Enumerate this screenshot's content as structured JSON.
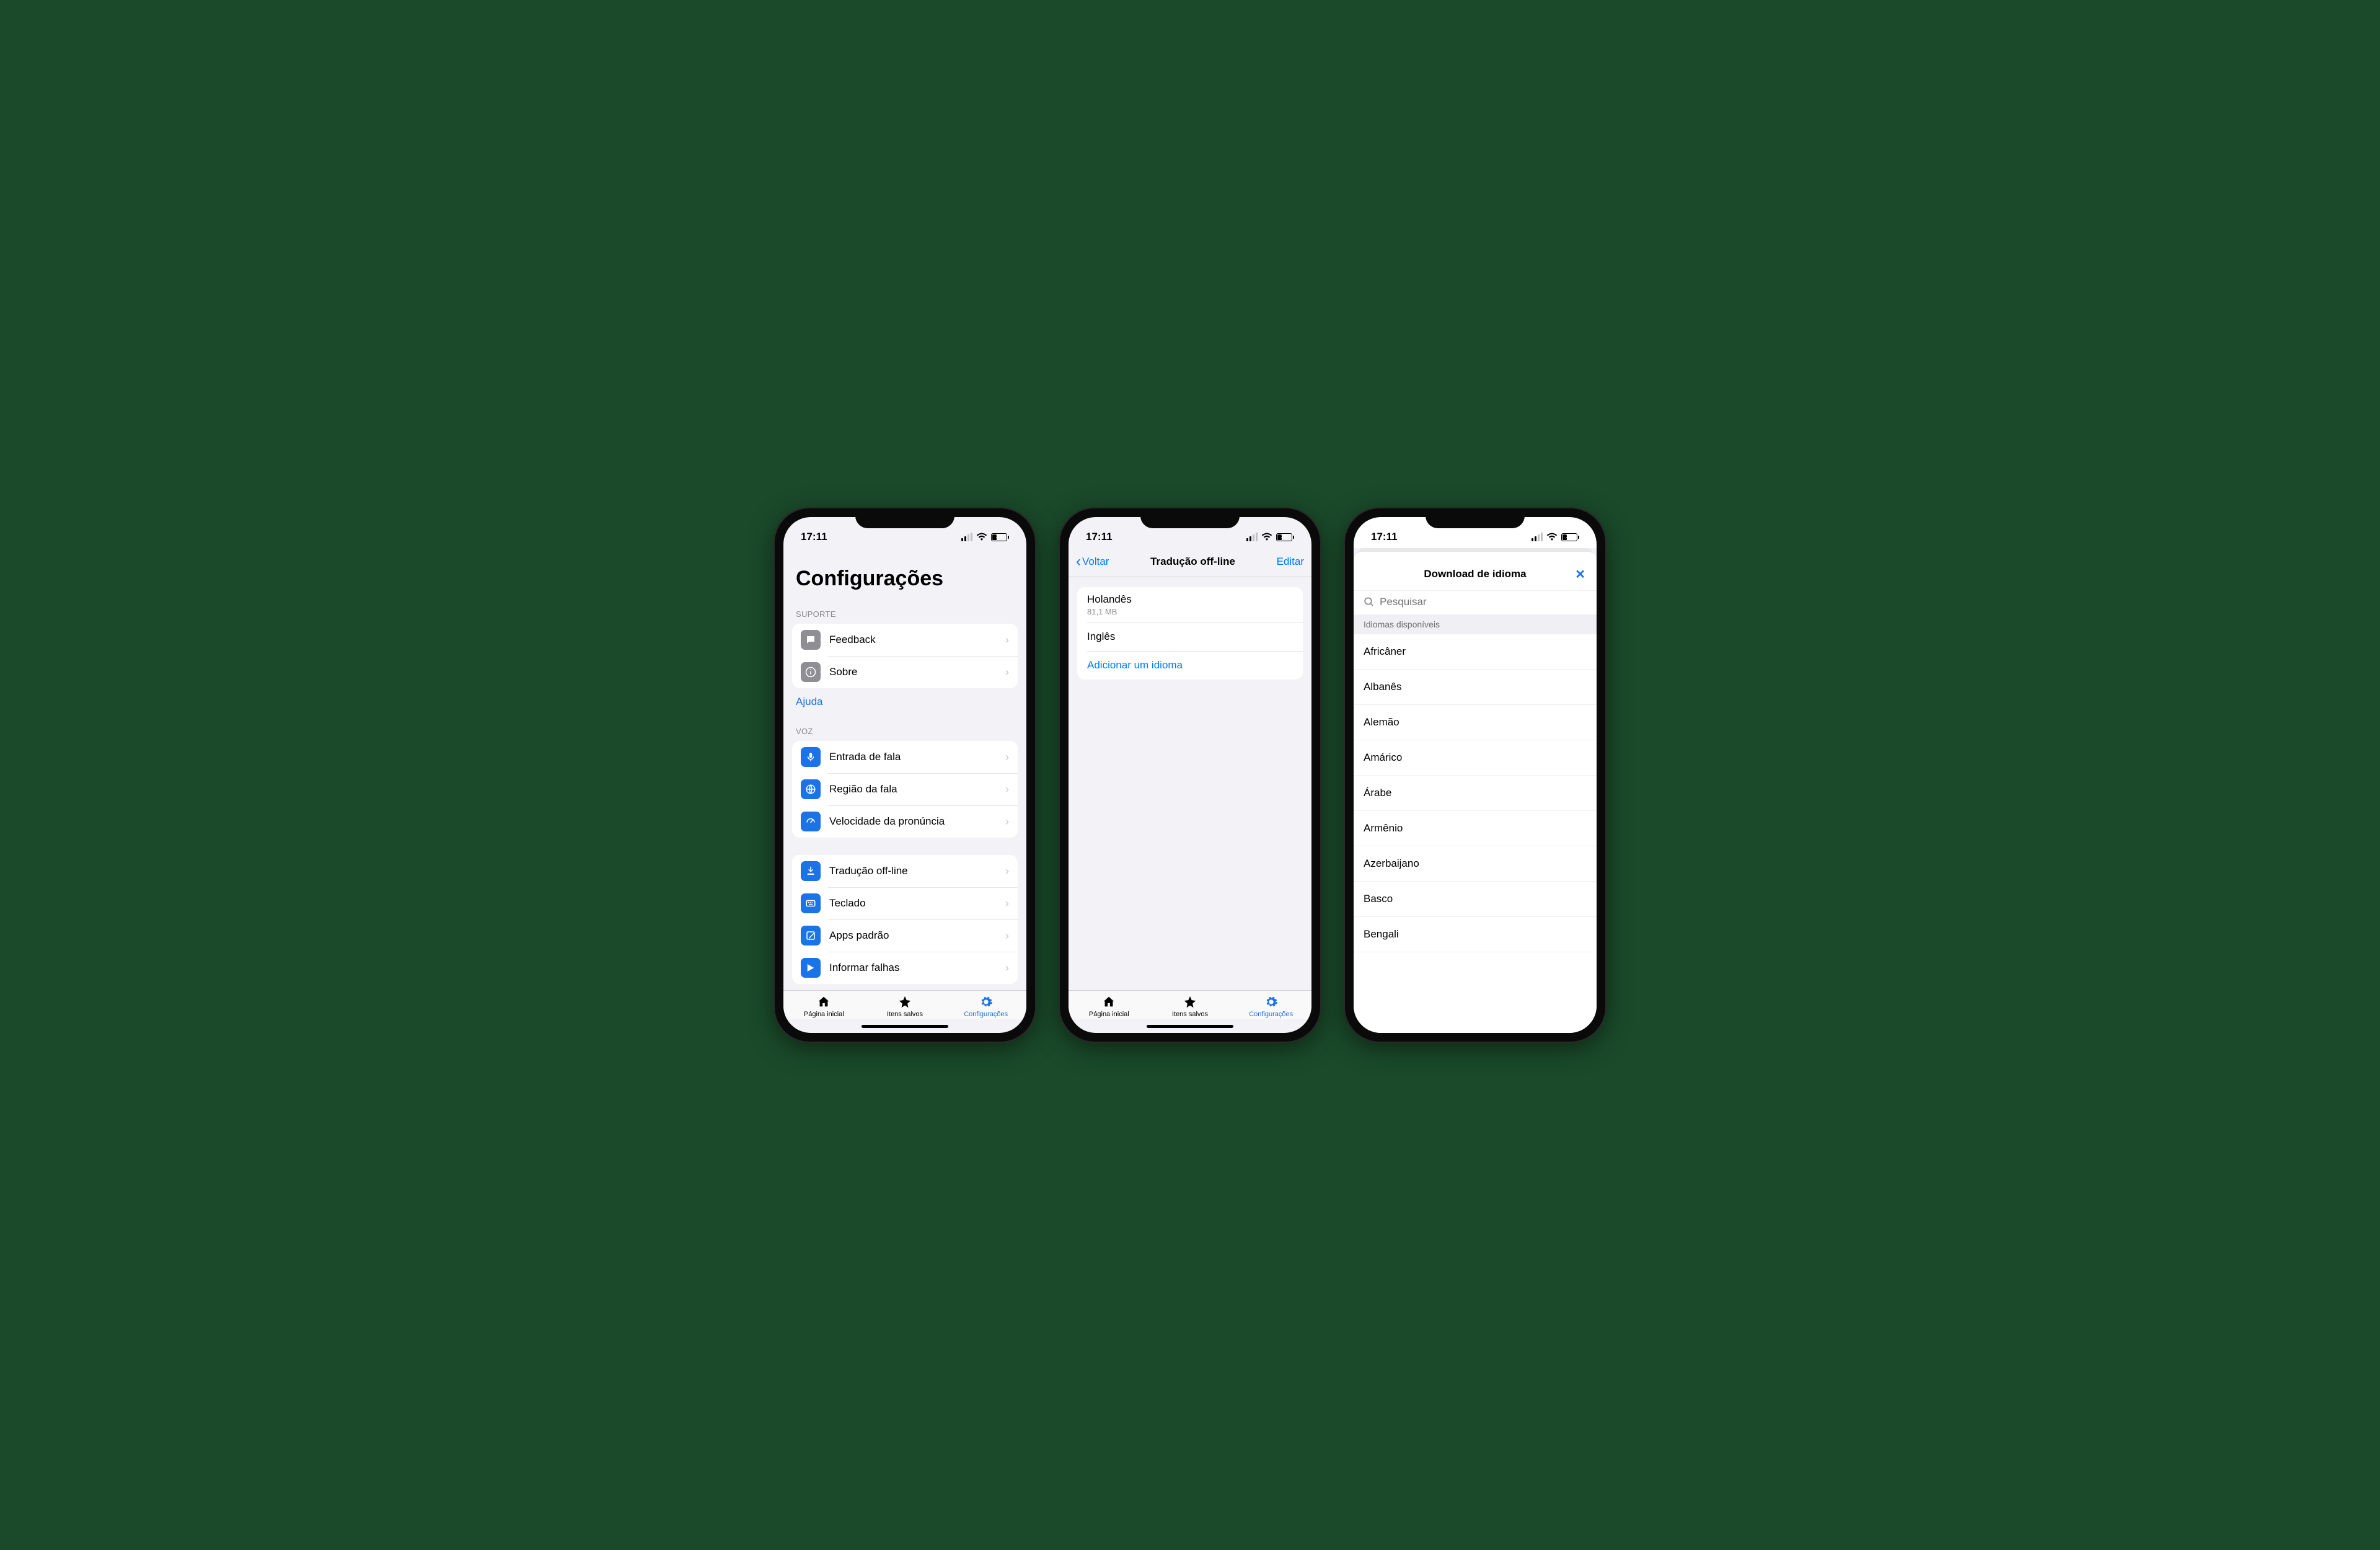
{
  "status": {
    "time": "17:11",
    "battery": "28"
  },
  "colors": {
    "accent": "#1a73e8",
    "ios_blue": "#007aff"
  },
  "screen1": {
    "title": "Configurações",
    "sections": {
      "support": {
        "label": "SUPORTE",
        "items": [
          {
            "icon": "feedback-icon",
            "label": "Feedback"
          },
          {
            "icon": "info-icon",
            "label": "Sobre"
          }
        ],
        "help_link": "Ajuda"
      },
      "voice": {
        "label": "VOZ",
        "items": [
          {
            "icon": "mic-icon",
            "label": "Entrada de fala"
          },
          {
            "icon": "globe-icon",
            "label": "Região da fala"
          },
          {
            "icon": "speed-icon",
            "label": "Velocidade da pronúncia"
          }
        ]
      },
      "other": {
        "items": [
          {
            "icon": "download-icon",
            "label": "Tradução off-line"
          },
          {
            "icon": "keyboard-icon",
            "label": "Teclado"
          },
          {
            "icon": "apps-icon",
            "label": "Apps padrão"
          },
          {
            "icon": "report-icon",
            "label": "Informar falhas"
          }
        ]
      }
    },
    "tabs": [
      {
        "label": "Página inicial",
        "active": false
      },
      {
        "label": "Itens salvos",
        "active": false
      },
      {
        "label": "Configurações",
        "active": true
      }
    ]
  },
  "screen2": {
    "back": "Voltar",
    "title": "Tradução off-line",
    "edit": "Editar",
    "languages": [
      {
        "name": "Holandês",
        "size": "81,1 MB"
      },
      {
        "name": "Inglês",
        "size": ""
      }
    ],
    "add": "Adicionar um idioma",
    "tabs": [
      {
        "label": "Página inicial",
        "active": false
      },
      {
        "label": "Itens salvos",
        "active": false
      },
      {
        "label": "Configurações",
        "active": true
      }
    ]
  },
  "screen3": {
    "title": "Download de idioma",
    "search_placeholder": "Pesquisar",
    "section": "Idiomas disponíveis",
    "languages": [
      "Africâner",
      "Albanês",
      "Alemão",
      "Amárico",
      "Árabe",
      "Armênio",
      "Azerbaijano",
      "Basco",
      "Bengali"
    ]
  }
}
